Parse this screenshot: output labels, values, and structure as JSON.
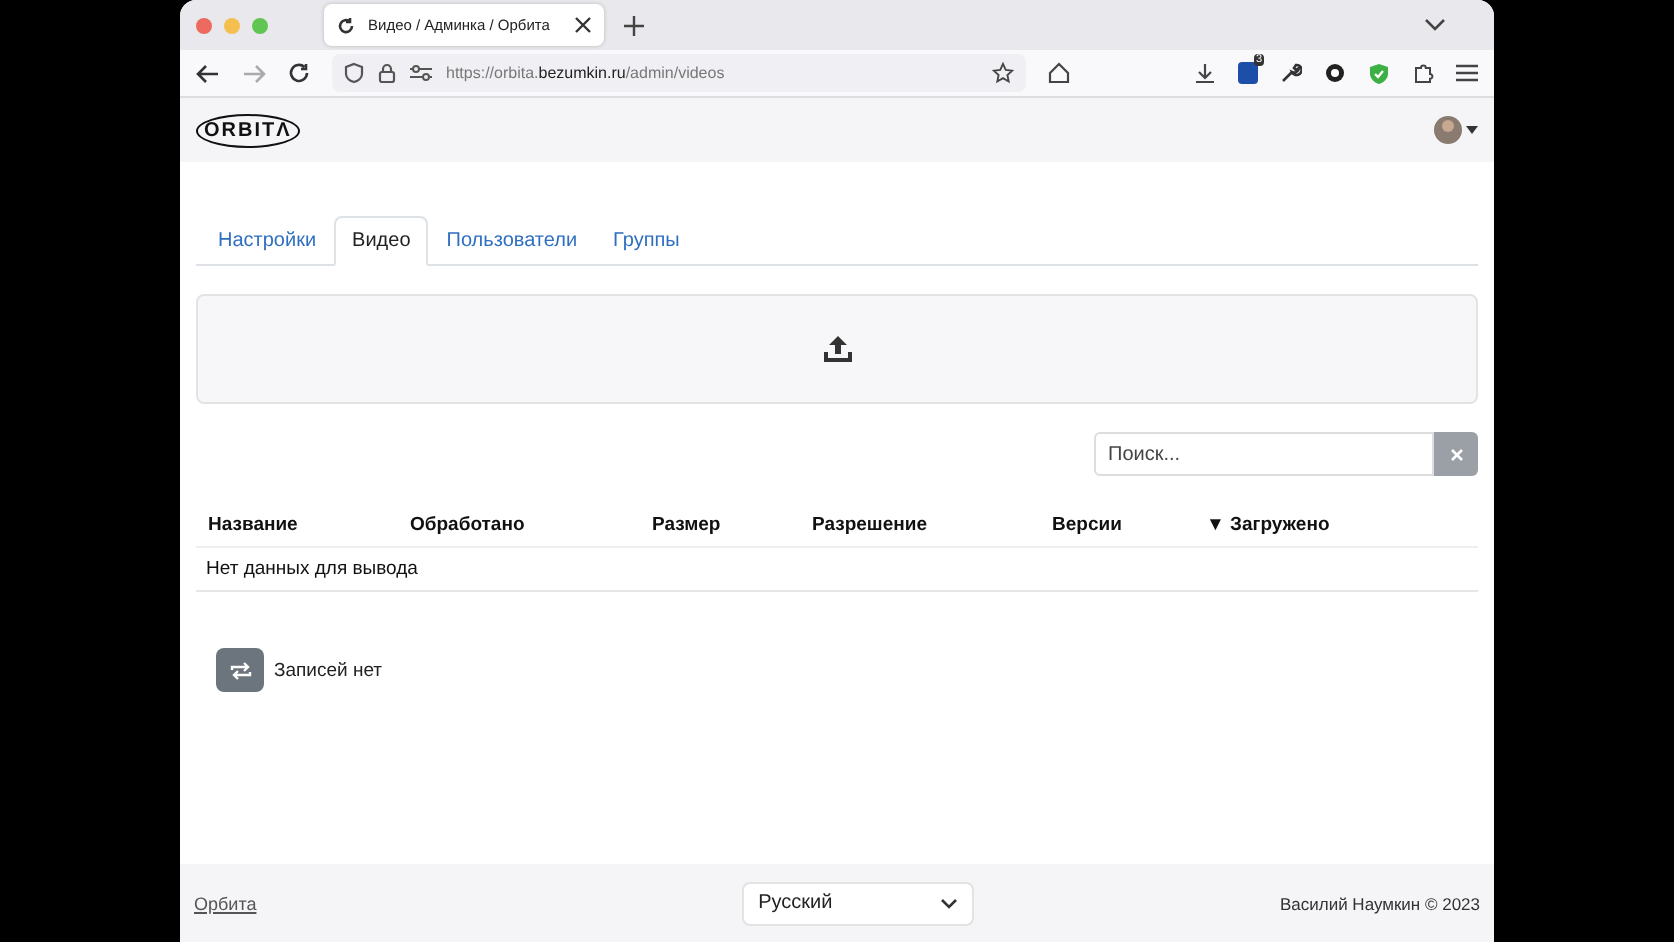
{
  "browser": {
    "tab_title": "Видео / Админка / Орбита",
    "url_prefix": "https://orbita.",
    "url_domain": "bezumkin.ru",
    "url_path": "/admin/videos",
    "extension_badge": "3"
  },
  "navbar": {
    "logo": "ORBITΛ"
  },
  "tabs": [
    {
      "label": "Настройки",
      "selected": false
    },
    {
      "label": "Видео",
      "selected": true
    },
    {
      "label": "Пользователи",
      "selected": false
    },
    {
      "label": "Группы",
      "selected": false
    }
  ],
  "search": {
    "placeholder": "Поиск..."
  },
  "table": {
    "columns": [
      {
        "label": "Название",
        "sorted": false
      },
      {
        "label": "Обработано",
        "sorted": false
      },
      {
        "label": "Размер",
        "sorted": false
      },
      {
        "label": "Разрешение",
        "sorted": false
      },
      {
        "label": "Версии",
        "sorted": false
      },
      {
        "label": "Загружено",
        "sorted": true
      }
    ],
    "sort_mark": "▼",
    "empty_text": "Нет данных для вывода"
  },
  "records_label": "Записей нет",
  "footer": {
    "link": "Орбита",
    "language": "Русский",
    "copyright": "Василий Наумкин © 2023"
  }
}
